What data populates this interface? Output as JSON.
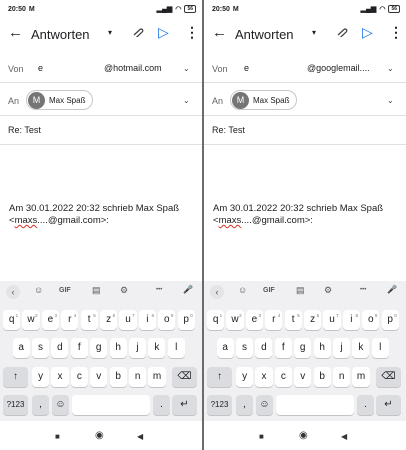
{
  "status": {
    "time": "20:50",
    "mail_icon": "M",
    "battery": "56"
  },
  "toolbar": {
    "title": "Antworten",
    "back_icon": "←",
    "dropdown_icon": "▾",
    "attach_icon": "⊘",
    "send_icon": "▷",
    "more_icon": "⋮"
  },
  "compose_left": {
    "from_label": "Von",
    "from_name": "e",
    "from_address": "@hotmail.com",
    "to_label": "An",
    "recipient_initial": "M",
    "recipient_name": "Max Spaß",
    "subject": "Re: Test",
    "quote_line1": "Am 30.01.2022 20:32 schrieb Max Spaß",
    "quote_prefix": "<",
    "quote_user": "maxs",
    "quote_rest": "....@gmail.com>:"
  },
  "compose_right": {
    "from_label": "Von",
    "from_name": "e",
    "from_address": "@googlemail....",
    "to_label": "An",
    "recipient_initial": "M",
    "recipient_name": "Max Spaß",
    "subject": "Re: Test",
    "quote_line1": "Am 30.01.2022 20:32 schrieb Max Spaß",
    "quote_prefix": "<",
    "quote_user": "maxs",
    "quote_rest": "....@gmail.com>:"
  },
  "keyboard": {
    "tools": [
      "‹",
      "☺",
      "GIF",
      "▤",
      "⚙",
      "•••",
      "🎤"
    ],
    "row1": [
      "q",
      "w",
      "e",
      "r",
      "t",
      "z",
      "u",
      "i",
      "o",
      "p"
    ],
    "row1_numbers": [
      "1",
      "2",
      "3",
      "4",
      "5",
      "6",
      "7",
      "8",
      "9",
      "0"
    ],
    "row2": [
      "a",
      "s",
      "d",
      "f",
      "g",
      "h",
      "j",
      "k",
      "l"
    ],
    "row3": [
      "y",
      "x",
      "c",
      "v",
      "b",
      "n",
      "m"
    ],
    "shift": "↑",
    "backspace": "⌫",
    "numbers_key": "?123",
    "comma": ",",
    "emoji": "☺",
    "period": ".",
    "enter": "↵"
  },
  "navbar": {
    "recents": "■",
    "home": "◉",
    "back": "◀"
  }
}
